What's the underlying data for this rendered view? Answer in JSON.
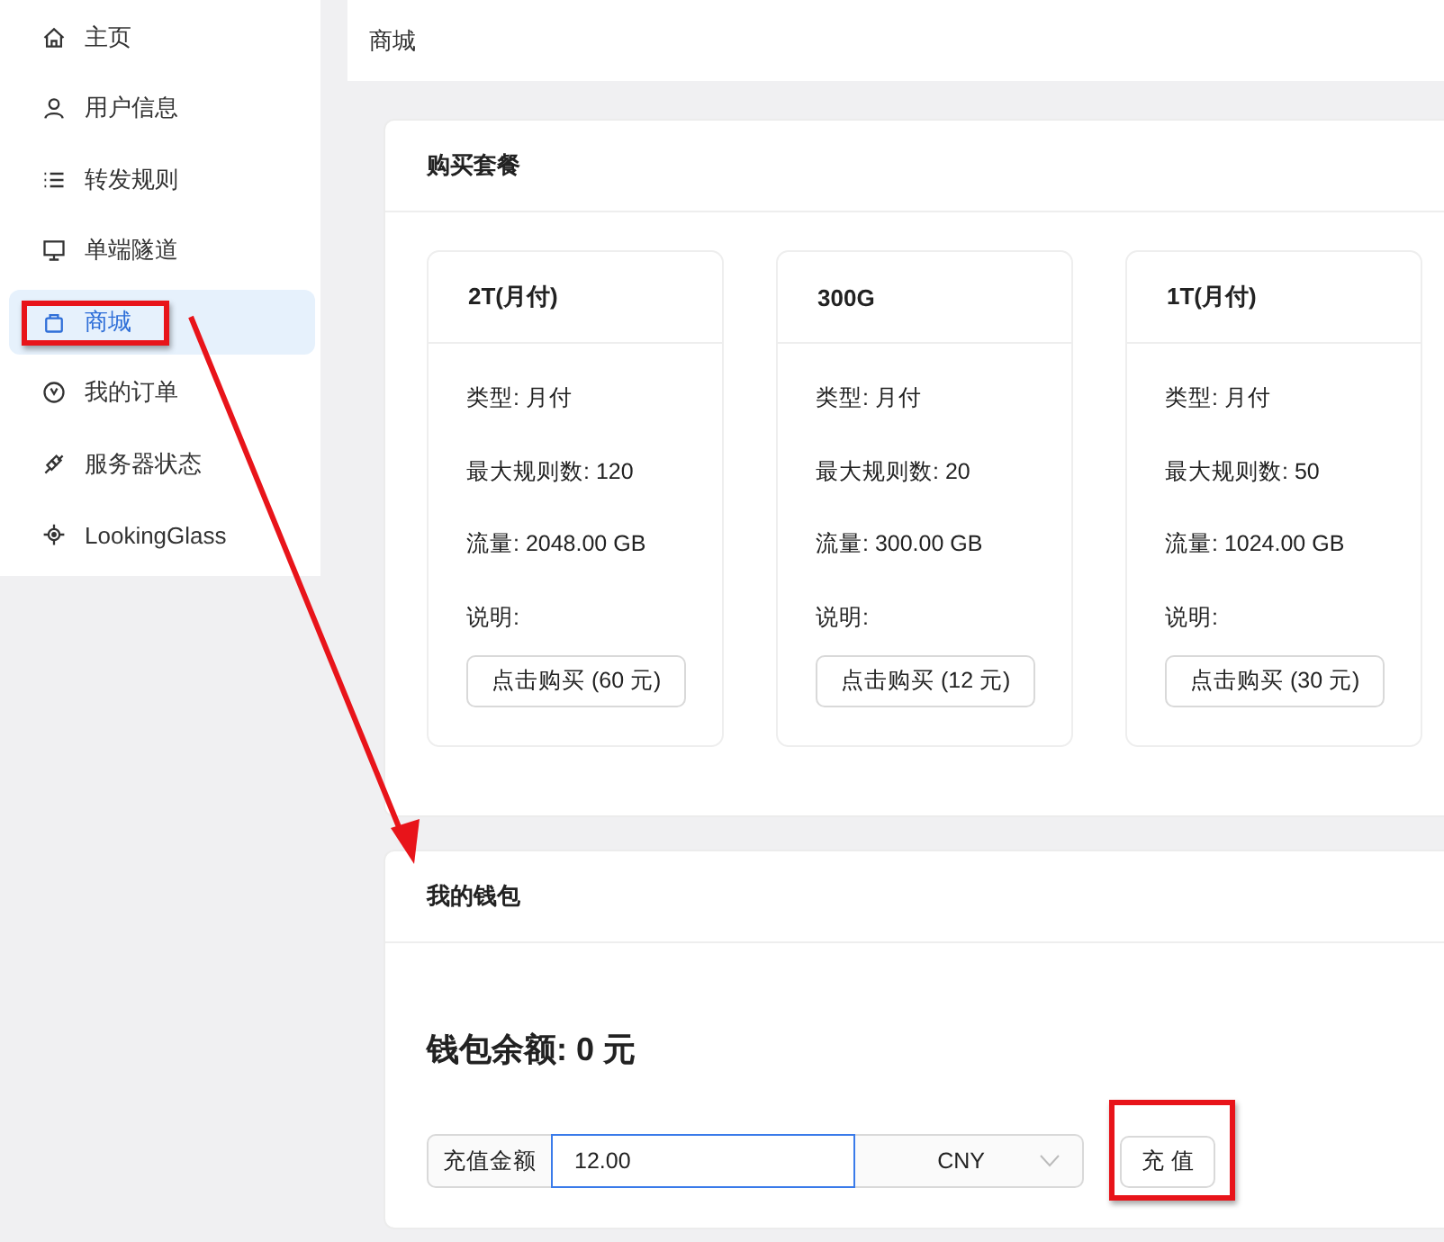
{
  "sidebar": {
    "items": [
      {
        "label": "主页",
        "selected": false
      },
      {
        "label": "用户信息",
        "selected": false
      },
      {
        "label": "转发规则",
        "selected": false
      },
      {
        "label": "单端隧道",
        "selected": false
      },
      {
        "label": "商城",
        "selected": true
      },
      {
        "label": "我的订单",
        "selected": false
      },
      {
        "label": "服务器状态",
        "selected": false
      },
      {
        "label": "LookingGlass",
        "selected": false
      }
    ]
  },
  "header": {
    "title": "商城"
  },
  "plans_panel": {
    "title": "购买套餐",
    "plans": [
      {
        "name": "2T(月付)",
        "lines": [
          "类型: 月付",
          "最大规则数: 120",
          "流量: 2048.00 GB",
          "说明:"
        ],
        "button": "点击购买 (60 元)"
      },
      {
        "name": "300G",
        "lines": [
          "类型: 月付",
          "最大规则数: 20",
          "流量: 300.00 GB",
          "说明:"
        ],
        "button": "点击购买 (12 元)"
      },
      {
        "name": "1T(月付)",
        "lines": [
          "类型: 月付",
          "最大规则数: 50",
          "流量: 1024.00 GB",
          "说明:"
        ],
        "button": "点击购买 (30 元)"
      }
    ]
  },
  "wallet_panel": {
    "title": "我的钱包",
    "balance": "钱包余额: 0 元",
    "amount_label": "充值金额",
    "amount": {
      "value": "12.00",
      "focused": true
    },
    "currency": "CNY",
    "button": "充 值"
  }
}
